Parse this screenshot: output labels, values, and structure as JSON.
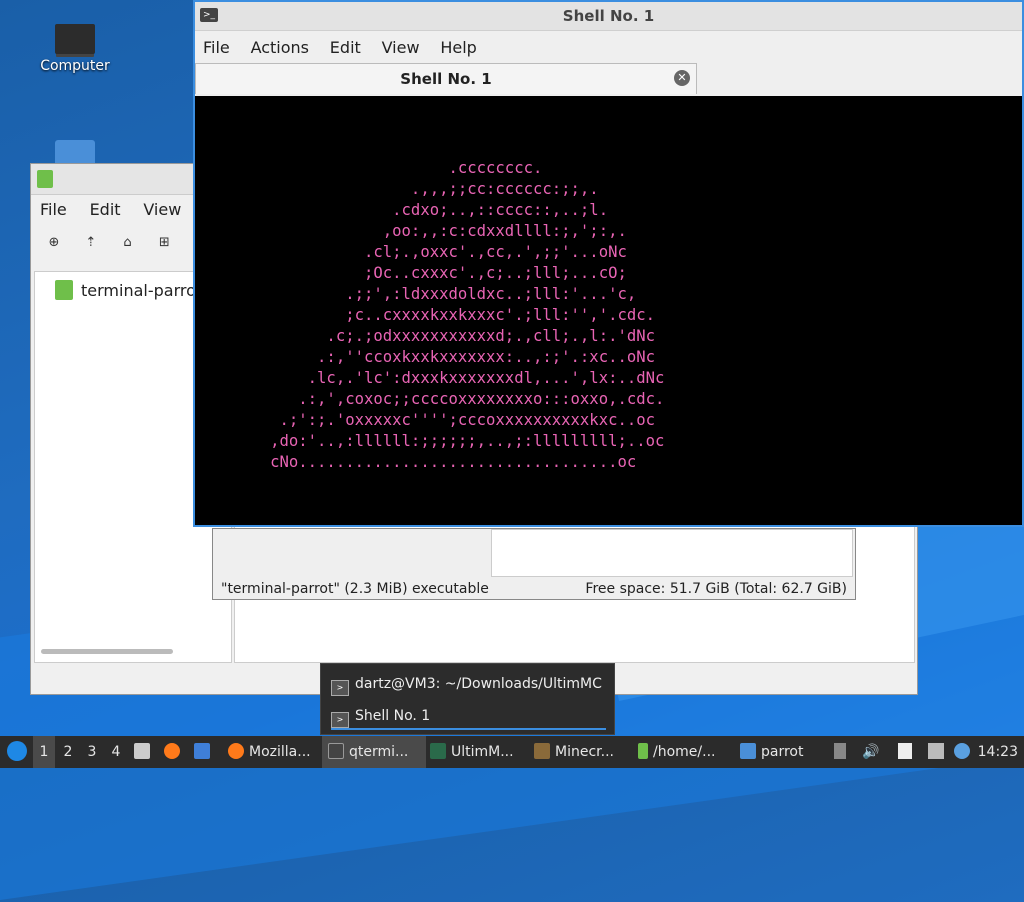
{
  "desktop": {
    "computer_label": "Computer"
  },
  "file_manager": {
    "menu": [
      "File",
      "Edit",
      "View"
    ],
    "sidebar_item": "terminal-parrot",
    "status_text": "\"terminal-parrot\" (2.3 MiB) executable",
    "free_space": "Free space: 51.7 GiB (Total: 62.7 GiB)"
  },
  "terminal": {
    "window_title": "Shell No. 1",
    "menu": [
      "File",
      "Actions",
      "Edit",
      "View",
      "Help"
    ],
    "tab_label": "Shell No. 1",
    "ascii_color": "#e864b4",
    "ascii_art": "                           .cccccccc.\n                       .,,,;;cc:cccccc:;;,.\n                     .cdxo;..,::cccc::,..;l.\n                    ,oo:,,:c:cdxxdllll:;,';:,.\n                  .cl;.,oxxc'.,cc,.',;;'...oNc\n                  ;Oc..cxxxc'.,c;..;lll;...cO;\n                .;;',:ldxxxdoldxc..;lll:'...'c,\n                ;c..cxxxxkxxkxxxc'.;lll:'','.cdc.\n              .c;.;odxxxxxxxxxxxd;.,cll;.,l:.'dNc\n             .:,''ccoxkxxkxxxxxxx:..,:;'.:xc..oNc\n            .lc,.'lc':dxxxkxxxxxxxdl,...',lx:..dNc\n           .:,',coxoc;;ccccoxxxxxxxxo:::oxxo,.cdc.\n         .;':;.'oxxxxxc'''';cccoxxxxxxxxxxkxc..oc\n        ,do:'..,:llllll:;;;;;;,..,;:lllllllll;..oc\n        cNo..................................oc"
  },
  "popup": {
    "items": [
      "dartz@VM3: ~/Downloads/UltimMC",
      "Shell No. 1"
    ]
  },
  "taskbar": {
    "desktops": [
      "1",
      "2",
      "3",
      "4"
    ],
    "tasks": [
      "Mozilla...",
      "qtermi...",
      "UltimM...",
      "Minecr...",
      "/home/...",
      "parrot"
    ],
    "clock": "14:23"
  }
}
